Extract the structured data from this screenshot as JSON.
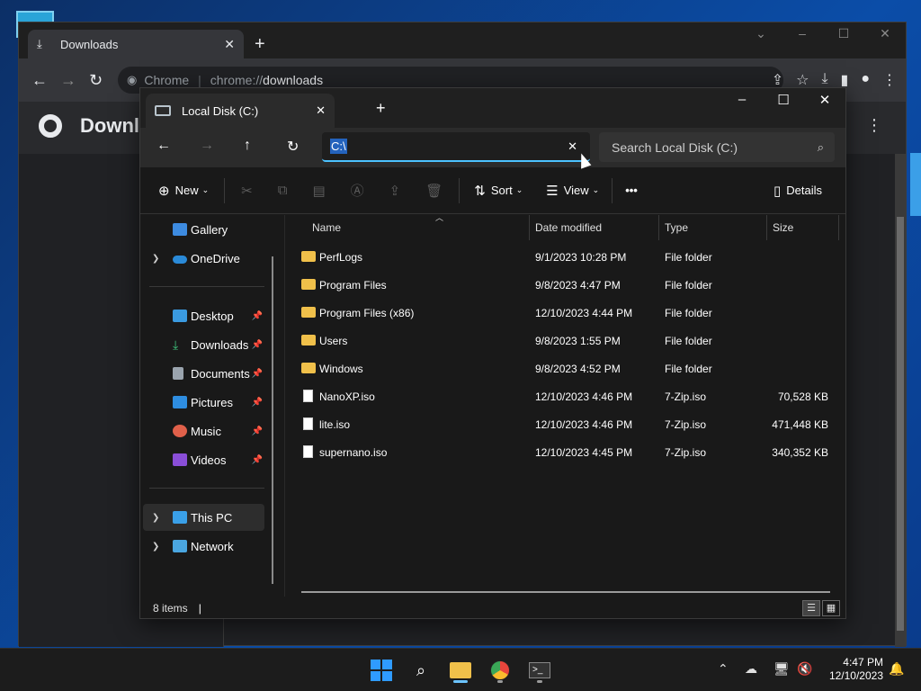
{
  "chrome": {
    "tab_title": "Downloads",
    "omnibox_label": "Chrome",
    "url_scheme": "chrome://",
    "url_host": "downloads",
    "page_title": "Downloads"
  },
  "explorer": {
    "tab_title": "Local Disk (C:)",
    "address_value": "C:\\",
    "search_placeholder": "Search Local Disk (C:)",
    "commands": {
      "new_label": "New",
      "sort_label": "Sort",
      "view_label": "View",
      "more_label": "•••",
      "details_label": "Details"
    },
    "sidebar": {
      "items": [
        {
          "label": "Gallery",
          "icon": "gallery-icon",
          "pinned": false
        },
        {
          "label": "OneDrive",
          "icon": "cloud-icon",
          "pinned": false
        },
        {
          "label": "Desktop",
          "icon": "desktop-icon",
          "pinned": true
        },
        {
          "label": "Downloads",
          "icon": "download-icon",
          "pinned": true
        },
        {
          "label": "Documents",
          "icon": "document-icon",
          "pinned": true
        },
        {
          "label": "Pictures",
          "icon": "pictures-icon",
          "pinned": true
        },
        {
          "label": "Music",
          "icon": "music-icon",
          "pinned": true
        },
        {
          "label": "Videos",
          "icon": "videos-icon",
          "pinned": true
        },
        {
          "label": "This PC",
          "icon": "computer-icon",
          "pinned": false
        },
        {
          "label": "Network",
          "icon": "network-icon",
          "pinned": false
        }
      ]
    },
    "columns": [
      "Name",
      "Date modified",
      "Type",
      "Size"
    ],
    "files": [
      {
        "name": "PerfLogs",
        "date": "9/1/2023 10:28 PM",
        "type": "File folder",
        "size": "",
        "kind": "folder"
      },
      {
        "name": "Program Files",
        "date": "9/8/2023 4:47 PM",
        "type": "File folder",
        "size": "",
        "kind": "folder"
      },
      {
        "name": "Program Files (x86)",
        "date": "12/10/2023 4:44 PM",
        "type": "File folder",
        "size": "",
        "kind": "folder"
      },
      {
        "name": "Users",
        "date": "9/8/2023 1:55 PM",
        "type": "File folder",
        "size": "",
        "kind": "folder"
      },
      {
        "name": "Windows",
        "date": "9/8/2023 4:52 PM",
        "type": "File folder",
        "size": "",
        "kind": "folder"
      },
      {
        "name": "NanoXP.iso",
        "date": "12/10/2023 4:46 PM",
        "type": "7-Zip.iso",
        "size": "70,528 KB",
        "kind": "file"
      },
      {
        "name": "lite.iso",
        "date": "12/10/2023 4:46 PM",
        "type": "7-Zip.iso",
        "size": "471,448 KB",
        "kind": "file"
      },
      {
        "name": "supernano.iso",
        "date": "12/10/2023 4:45 PM",
        "type": "7-Zip.iso",
        "size": "340,352 KB",
        "kind": "file"
      }
    ],
    "status_text": "8 items"
  },
  "taskbar": {
    "time": "4:47 PM",
    "date": "12/10/2023"
  },
  "colors": {
    "accent": "#4cc2ff",
    "folder": "#f0c04a",
    "selection": "#2463bd"
  }
}
